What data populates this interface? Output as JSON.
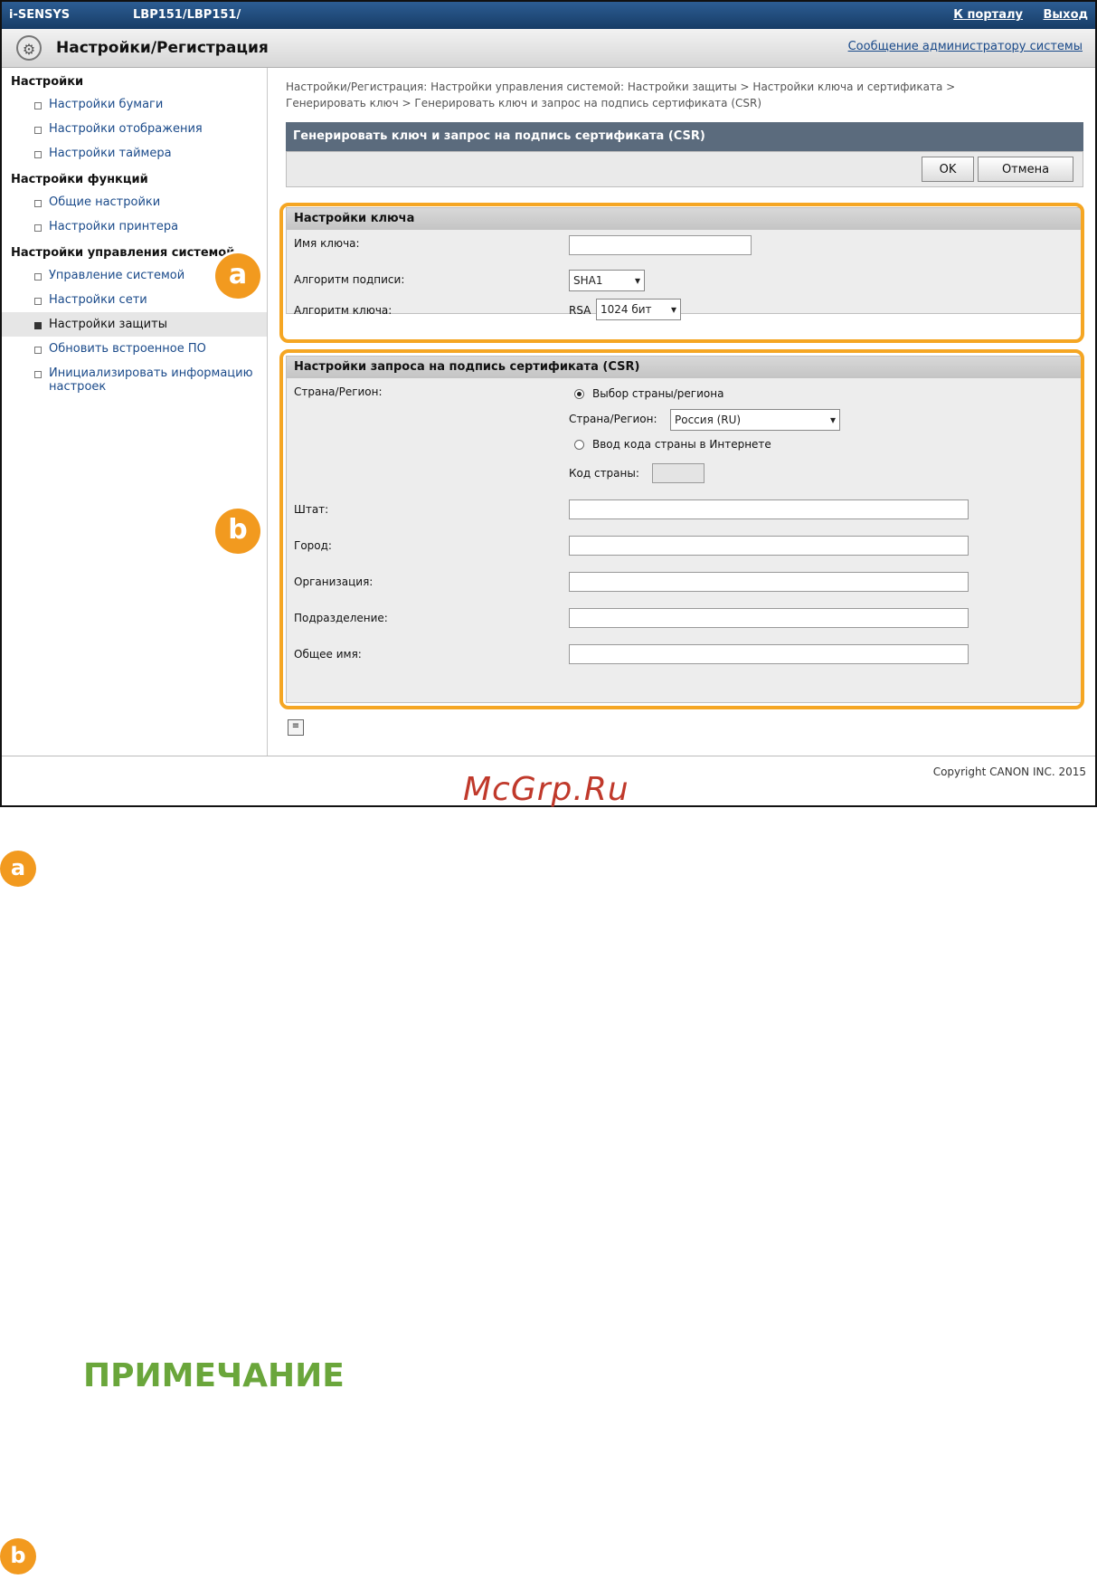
{
  "topbar": {
    "brand": "i-SENSYS",
    "model": "LBP151/LBP151/",
    "portal": "К порталу",
    "logout": "Выход"
  },
  "titlebar": {
    "title": "Настройки/Регистрация",
    "admin_link": "Сообщение администратору системы"
  },
  "sidebar": {
    "groups": [
      {
        "label": "Настройки",
        "items": [
          "Настройки бумаги",
          "Настройки отображения",
          "Настройки таймера"
        ]
      },
      {
        "label": "Настройки функций",
        "items": [
          "Общие настройки",
          "Настройки принтера"
        ]
      },
      {
        "label": "Настройки управления системой",
        "items": [
          "Управление системой",
          "Настройки сети",
          "Настройки защиты",
          "Обновить встроенное ПО",
          "Инициализировать информацию настроек"
        ]
      }
    ]
  },
  "main": {
    "breadcrumb": "Настройки/Регистрация: Настройки управления системой: Настройки защиты > Настройки ключа и сертификата > Генерировать ключ > Генерировать ключ и запрос на подпись сертификата (CSR)",
    "panel_title": "Генерировать ключ и запрос на подпись сертификата (CSR)",
    "ok_label": "OK",
    "cancel_label": "Отмена",
    "key_section": {
      "title": "Настройки ключа",
      "key_name_label": "Имя ключа:",
      "key_name_value": "",
      "sig_alg_label": "Алгоритм подписи:",
      "sig_alg_value": "SHA1",
      "key_alg_label": "Алгоритм ключа:",
      "key_alg_prefix": "RSA",
      "key_alg_value": "1024 бит"
    },
    "csr_section": {
      "title": "Настройки запроса на подпись сертификата (CSR)",
      "country_label": "Страна/Регион:",
      "radio_select_label": "Выбор страны/региона",
      "country_select_label": "Страна/Регион:",
      "country_select_value": "Россия (RU)",
      "radio_internet_label": "Ввод кода страны в Интернете",
      "country_code_label": "Код страны:",
      "country_code_value": "",
      "state_label": "Штат:",
      "city_label": "Город:",
      "org_label": "Организация:",
      "dept_label": "Подразделение:",
      "common_name_label": "Общее имя:"
    }
  },
  "footer": {
    "copyright": "Copyright CANON INC. 2015"
  },
  "annotations": {
    "badge_a": "a",
    "badge_b": "b"
  },
  "watermark": "McGrp.Ru",
  "note_heading": "ПРИМЕЧАНИЕ",
  "colors": {
    "highlight": "#f5a623",
    "badge": "#f29a1f",
    "note": "#6aa63b",
    "header_bar": "#1f4f84"
  }
}
